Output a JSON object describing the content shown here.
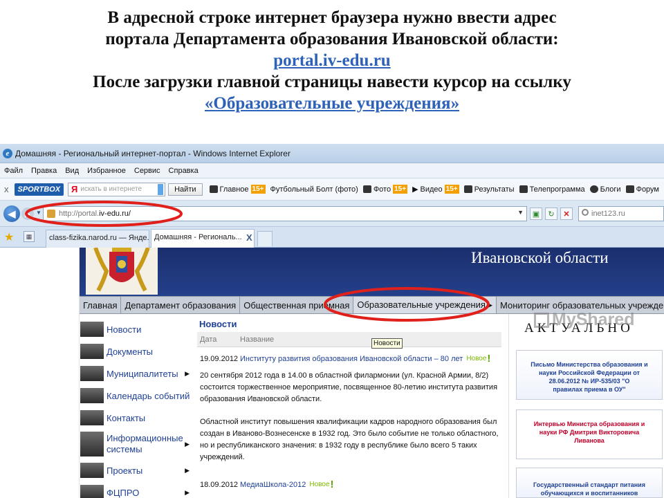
{
  "caption": {
    "line1": "В адресной строке интернет браузера нужно ввести адрес",
    "line2": "портала Департамента образования Ивановской области:",
    "link1": "portal.iv-edu.ru",
    "line3": "После загрузки главной страницы навести курсор на ссылку",
    "link2": "«Образовательные учреждения»"
  },
  "browser": {
    "title": "Домашняя - Региональный интернет-портал - Windows Internet Explorer",
    "menu": [
      "Файл",
      "Правка",
      "Вид",
      "Избранное",
      "Сервис",
      "Справка"
    ],
    "linksbar": {
      "close": "x",
      "sportbox": "SPORTBOX",
      "search_logo": "Я",
      "search_placeholder": "искать в интернете",
      "find_button": "Найти",
      "items": [
        {
          "label": "Главное",
          "badge": "15+"
        },
        {
          "label": "Футбольный Болт (фото)",
          "badge": ""
        },
        {
          "label": "Фото",
          "badge": "15+"
        },
        {
          "label": "Видео",
          "badge": "15+"
        },
        {
          "label": "Результаты",
          "badge": ""
        },
        {
          "label": "Телепрограмма",
          "badge": ""
        },
        {
          "label": "Блоги",
          "badge": ""
        },
        {
          "label": "Форум",
          "badge": ""
        }
      ]
    },
    "address": {
      "prefix": "http://portal.",
      "host": "iv-edu.ru/",
      "search_value": "inet123.ru"
    },
    "tabs": [
      {
        "label": "class-fizika.narod.ru — Янде..."
      },
      {
        "label": "Домашняя - Региональ..."
      }
    ],
    "tab_close": "X"
  },
  "portal": {
    "banner_title": "Ивановской области",
    "nav": [
      "Главная",
      "Департамент образования",
      "Общественная приемная",
      "Образовательные учреждения ▸",
      "Мониторинг образовательных учреждений"
    ],
    "sidemenu": [
      {
        "label": "Новости",
        "arrow": ""
      },
      {
        "label": "Документы",
        "arrow": ""
      },
      {
        "label": "Муниципалитеты",
        "arrow": "▶"
      },
      {
        "label": "Календарь событий",
        "arrow": ""
      },
      {
        "label": "Контакты",
        "arrow": ""
      },
      {
        "label": "Информационные системы",
        "arrow": "▶"
      },
      {
        "label": "Проекты",
        "arrow": "▶"
      },
      {
        "label": "ФЦПРО",
        "arrow": "▶"
      }
    ],
    "news": {
      "title": "Новости",
      "col_date": "Дата",
      "col_name": "Название",
      "tooltip": "Новости",
      "items": [
        {
          "date": "19.09.2012",
          "title": "Институту развития образования Ивановской области – 80 лет",
          "new_label": "Новое",
          "body1": "20 сентября 2012 года в 14.00 в областной филармонии (ул. Красной Армии, 8/2) состоится торжественное мероприятие, посвященное 80-летию института развития образования Ивановской области.",
          "body2": "Областной институт повышения квалификации кадров народного образования был создан в Иваново-Вознесенске в 1932 год. Это было событие не только областного, но и республиканского значения: в 1932 году в республике было всего 5 таких учреждений."
        },
        {
          "date": "18.09.2012",
          "title": "МедиаШкола-2012",
          "new_label": "Новое"
        }
      ]
    },
    "aside": {
      "title": "АКТУАЛЬНО",
      "card1": [
        "Письмо Министерства образования и",
        "науки Российской Федерации от",
        "28.06.2012 № ИР-535/03 \"О",
        "правилах приема в ОУ\""
      ],
      "card2": [
        "Интервью Министра образования и",
        "науки РФ Дмитрия Викторовича",
        "Ливанова"
      ],
      "card3": [
        "Государственный стандарт питания",
        "обучающихся и воспитанников"
      ]
    },
    "watermark": "MyShared"
  },
  "colors": {
    "annotation": "#e0201b",
    "banner": "#1b2f6e",
    "link": "#1e3f96"
  }
}
